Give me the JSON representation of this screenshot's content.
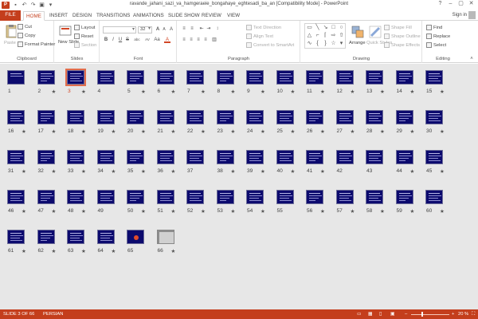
{
  "window": {
    "title": "ravande_jahani_sazi_va_hamgeraeie_bongahaye_eghtesadi_ba_an [Compatibility Mode] - PowerPoint",
    "app_icon_letter": "P",
    "minimize": "–",
    "maximize": "▢",
    "close": "✕",
    "help": "?"
  },
  "qat": {
    "save": "▪",
    "undo": "↶",
    "redo": "↷",
    "start": "▣",
    "customize": "▾"
  },
  "tabs": [
    {
      "label": "FILE"
    },
    {
      "label": "HOME"
    },
    {
      "label": "INSERT"
    },
    {
      "label": "DESIGN"
    },
    {
      "label": "TRANSITIONS"
    },
    {
      "label": "ANIMATIONS"
    },
    {
      "label": "SLIDE SHOW"
    },
    {
      "label": "REVIEW"
    },
    {
      "label": "VIEW"
    }
  ],
  "account": {
    "signin": "Sign in"
  },
  "ribbon": {
    "clipboard": {
      "label": "Clipboard",
      "paste": "Paste",
      "cut": "Cut",
      "copy": "Copy",
      "format_painter": "Format Painter"
    },
    "slides": {
      "label": "Slides",
      "new_slide": "New Slide",
      "layout": "Layout",
      "reset": "Reset",
      "section": "Section"
    },
    "font": {
      "label": "Font",
      "size": "32",
      "bold": "B",
      "italic": "I",
      "underline": "U",
      "strike": "S",
      "shadow": "abc",
      "spacing": "AV",
      "case": "Aa",
      "color": "A",
      "grow": "A",
      "shrink": "A",
      "clear": "A"
    },
    "paragraph": {
      "label": "Paragraph",
      "text_direction": "Text Direction",
      "align_text": "Align Text",
      "convert_smartart": "Convert to SmartArt"
    },
    "drawing": {
      "label": "Drawing",
      "arrange": "Arrange",
      "quick_styles": "Quick Styles",
      "shape_fill": "Shape Fill",
      "shape_outline": "Shape Outline",
      "shape_effects": "Shape Effects"
    },
    "editing": {
      "label": "Editing",
      "find": "Find",
      "replace": "Replace",
      "select": "Select"
    }
  },
  "slides": [
    {
      "n": "1",
      "star": ""
    },
    {
      "n": "2",
      "star": "★"
    },
    {
      "n": "3",
      "star": "★"
    },
    {
      "n": "4",
      "star": ""
    },
    {
      "n": "5",
      "star": "★"
    },
    {
      "n": "6",
      "star": "★"
    },
    {
      "n": "7",
      "star": "★"
    },
    {
      "n": "8",
      "star": "★"
    },
    {
      "n": "9",
      "star": "★"
    },
    {
      "n": "10",
      "star": "★"
    },
    {
      "n": "11",
      "star": "★"
    },
    {
      "n": "12",
      "star": "★"
    },
    {
      "n": "13",
      "star": "★"
    },
    {
      "n": "14",
      "star": "★"
    },
    {
      "n": "15",
      "star": "★"
    },
    {
      "n": "16",
      "star": "★"
    },
    {
      "n": "17",
      "star": "★"
    },
    {
      "n": "18",
      "star": "★"
    },
    {
      "n": "19",
      "star": "★"
    },
    {
      "n": "20",
      "star": "★"
    },
    {
      "n": "21",
      "star": "★"
    },
    {
      "n": "22",
      "star": "★"
    },
    {
      "n": "23",
      "star": "★"
    },
    {
      "n": "24",
      "star": "★"
    },
    {
      "n": "25",
      "star": "★"
    },
    {
      "n": "26",
      "star": "★"
    },
    {
      "n": "27",
      "star": "★"
    },
    {
      "n": "28",
      "star": "★"
    },
    {
      "n": "29",
      "star": "★"
    },
    {
      "n": "30",
      "star": "★"
    },
    {
      "n": "31",
      "star": "★"
    },
    {
      "n": "32",
      "star": "★"
    },
    {
      "n": "33",
      "star": "★"
    },
    {
      "n": "34",
      "star": "★"
    },
    {
      "n": "35",
      "star": "★"
    },
    {
      "n": "36",
      "star": "★"
    },
    {
      "n": "37",
      "star": ""
    },
    {
      "n": "38",
      "star": "★"
    },
    {
      "n": "39",
      "star": "★"
    },
    {
      "n": "40",
      "star": "★"
    },
    {
      "n": "41",
      "star": "★"
    },
    {
      "n": "42",
      "star": ""
    },
    {
      "n": "43",
      "star": ""
    },
    {
      "n": "44",
      "star": "★"
    },
    {
      "n": "45",
      "star": "★"
    },
    {
      "n": "46",
      "star": "★"
    },
    {
      "n": "47",
      "star": "★"
    },
    {
      "n": "48",
      "star": "★"
    },
    {
      "n": "49",
      "star": ""
    },
    {
      "n": "50",
      "star": "★"
    },
    {
      "n": "51",
      "star": "★"
    },
    {
      "n": "52",
      "star": "★"
    },
    {
      "n": "53",
      "star": "★"
    },
    {
      "n": "54",
      "star": "★"
    },
    {
      "n": "55",
      "star": ""
    },
    {
      "n": "56",
      "star": "★"
    },
    {
      "n": "57",
      "star": "★"
    },
    {
      "n": "58",
      "star": "★"
    },
    {
      "n": "59",
      "star": "★"
    },
    {
      "n": "60",
      "star": "★"
    },
    {
      "n": "61",
      "star": "★"
    },
    {
      "n": "62",
      "star": "★"
    },
    {
      "n": "63",
      "star": "★"
    },
    {
      "n": "64",
      "star": "★"
    },
    {
      "n": "65",
      "star": ""
    },
    {
      "n": "66",
      "star": "★"
    }
  ],
  "status": {
    "slide_info": "SLIDE 3 OF 66",
    "language": "PERSIAN",
    "zoom": "20 %",
    "zoom_minus": "–",
    "zoom_plus": "+",
    "zoom_fraction": 0.2
  }
}
